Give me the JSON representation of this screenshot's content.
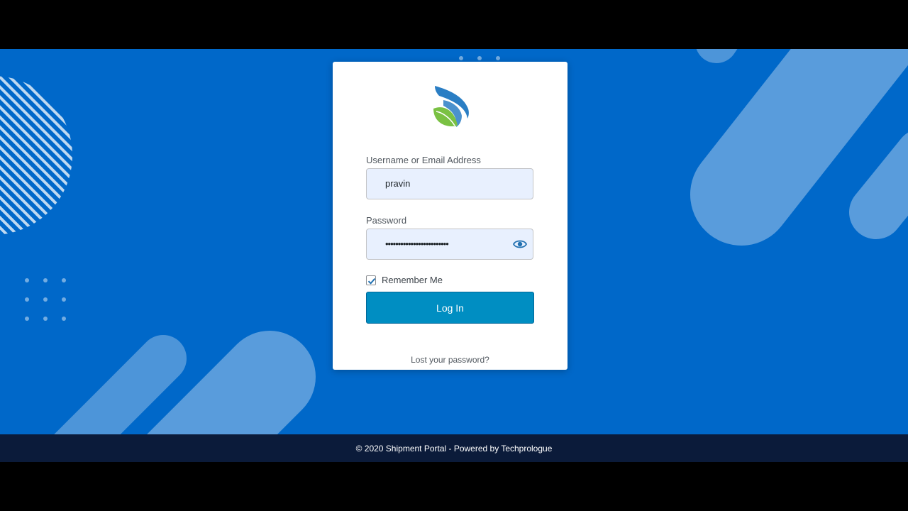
{
  "login": {
    "username_label": "Username or Email Address",
    "username_value": "pravin",
    "password_label": "Password",
    "password_masked": "•••••••••••••••••••••••••",
    "remember_label": "Remember Me",
    "remember_checked": true,
    "submit_label": "Log In",
    "lost_password_link": "Lost your password?"
  },
  "footer": {
    "text": "© 2020 Shipment Portal - Powered by Techprologue"
  },
  "icons": {
    "logo": "brand-logo-icon",
    "password_toggle": "eye-icon",
    "checkbox": "checkmark-icon"
  },
  "colors": {
    "background": "#0068c9",
    "button": "#008ec2",
    "footer": "#0b1b3a",
    "input_fill": "#e8f0fe"
  }
}
